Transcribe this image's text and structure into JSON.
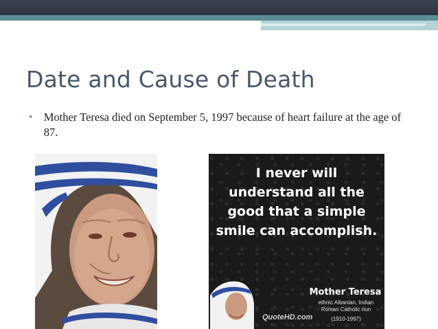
{
  "slide": {
    "title": "Date and Cause of Death",
    "bullets": [
      "Mother Teresa died on September 5, 1997 because of heart failure at the age of 87."
    ]
  },
  "quote_card": {
    "quote": "I never will understand all the good that a simple smile can accomplish.",
    "author": "Mother Teresa",
    "description": "ethnic Albanian, Indian Roman Catholic nun",
    "dates": "(1910-1997)",
    "site": "QuoteHD.com"
  },
  "colors": {
    "title": "#475867",
    "accent_teal": "#5a8e94",
    "header_dark": "#3d4450"
  }
}
